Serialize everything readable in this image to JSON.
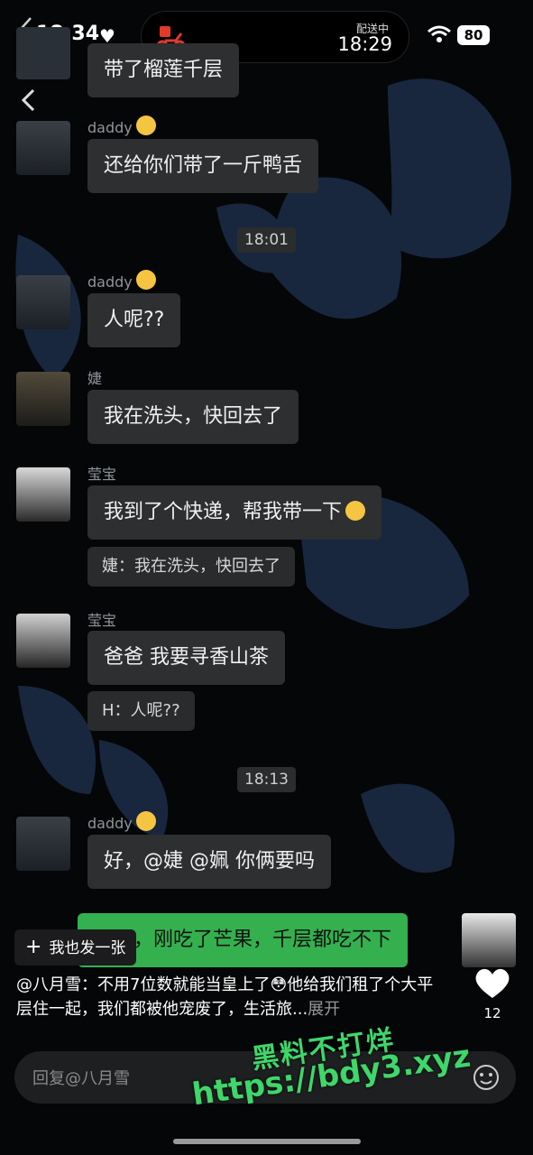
{
  "status": {
    "time": "18:34",
    "island_sub": "配送中",
    "island_time": "18:29",
    "battery": "80"
  },
  "messages": [
    {
      "text": "带了榴莲千层"
    },
    {
      "sender": "daddy",
      "text": "还给你们带了一斤鸭舌"
    },
    {
      "time": "18:01"
    },
    {
      "sender": "daddy",
      "text": "人呢??"
    },
    {
      "sender": "婕",
      "text": "我在洗头，快回去了"
    },
    {
      "sender": "莹宝",
      "text": "我到了个快递，帮我带一下",
      "quote": "婕：我在洗头，快回去了"
    },
    {
      "sender": "莹宝",
      "text": "爸爸 我要寻香山茶",
      "quote": "H：人呢??"
    },
    {
      "time": "18:13"
    },
    {
      "sender": "daddy",
      "text": "好，@婕 @姵 你俩要吗"
    },
    {
      "text": "不要，刚吃了芒果，千层都吃不下"
    }
  ],
  "overlay": {
    "fab_label": "我也发一张",
    "caption": "@八月雪：不用7位数就能当皇上了😳他给我们租了个大平层住一起，我们都被他宠废了，生活旅...",
    "expand": "展开",
    "like_count": "12",
    "reply_placeholder": "回复@八月雪",
    "watermark_line1": "黑料不打烊",
    "watermark_line2": "https://bdy3.xyz"
  },
  "colors": {
    "bubble": "#2d2f31",
    "self_bubble": "#34b04f",
    "watermark": "#3fd66a"
  }
}
